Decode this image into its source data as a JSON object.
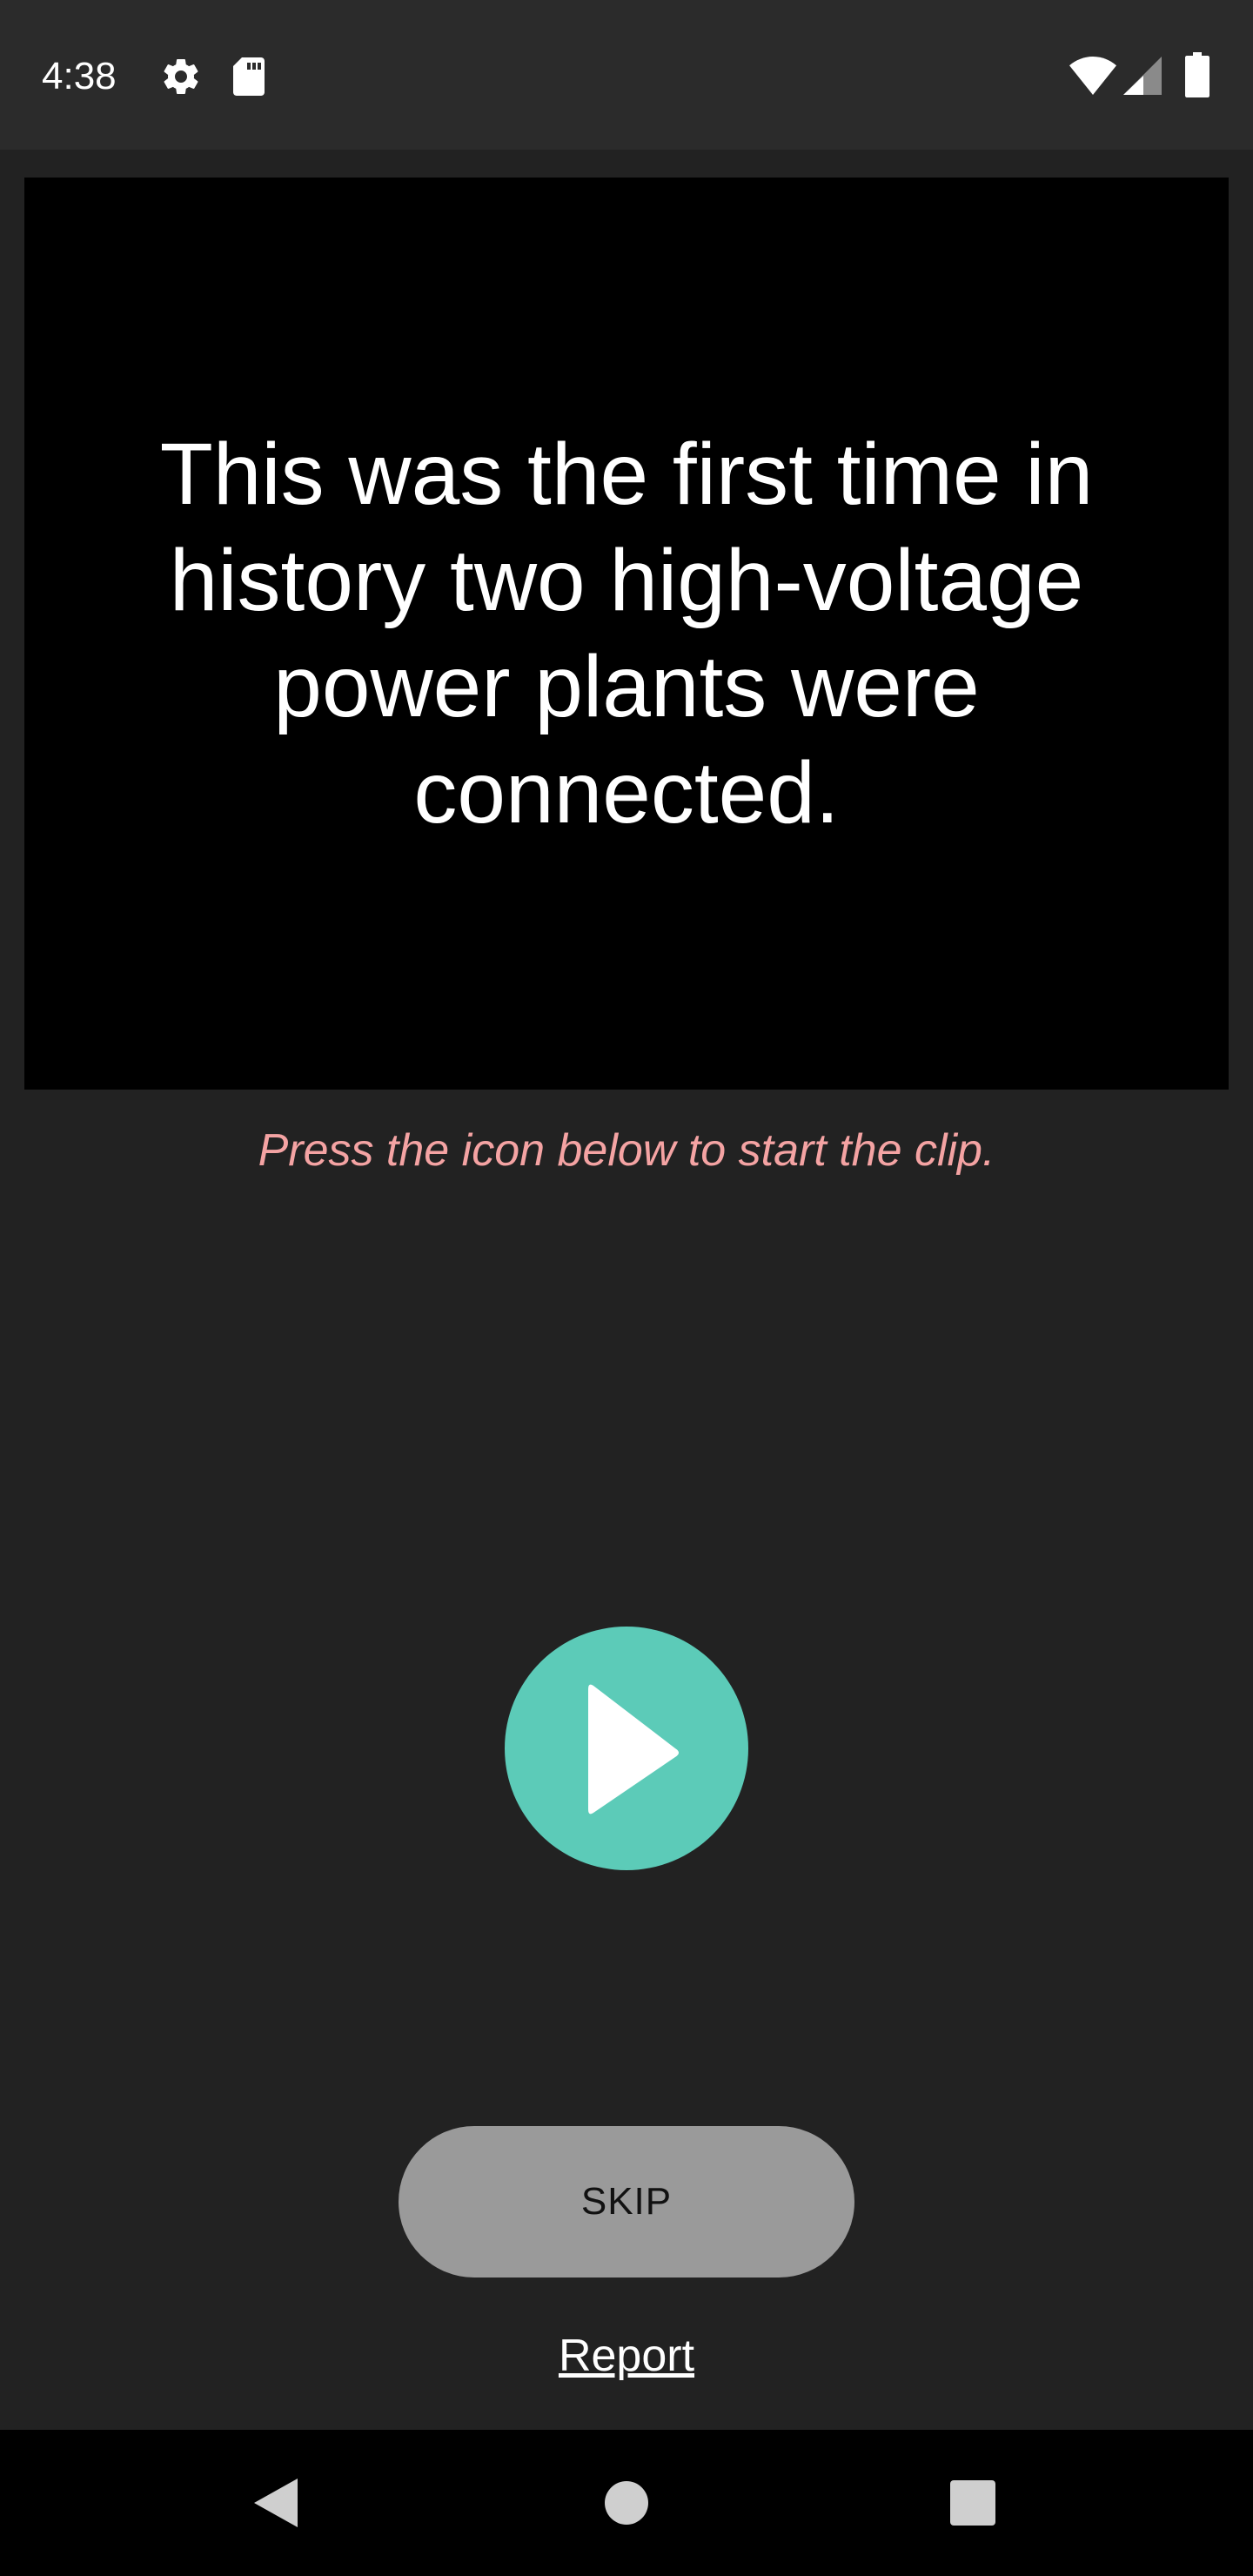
{
  "status_bar": {
    "time": "4:38",
    "icons": [
      "settings-gear-icon",
      "sd-card-icon",
      "wifi-icon",
      "cell-signal-icon",
      "battery-icon"
    ]
  },
  "caption": {
    "text": "This was the first time in history two high-voltage power plants were connected."
  },
  "hint": {
    "text": "Press the icon below to start the clip."
  },
  "play_button": {
    "icon": "play-icon"
  },
  "skip_button": {
    "label": "SKIP"
  },
  "report_link": {
    "label": "Report"
  },
  "nav_bar": {
    "icons": [
      "back-triangle-icon",
      "home-circle-icon",
      "recents-square-icon"
    ]
  },
  "colors": {
    "background": "#222222",
    "status_bar": "#2b2b2b",
    "caption_card": "#000000",
    "hint_text": "#f4a3a3",
    "play_button": "#5ccbb8",
    "skip_button": "#9a9a9a",
    "nav_bar": "#000000"
  }
}
